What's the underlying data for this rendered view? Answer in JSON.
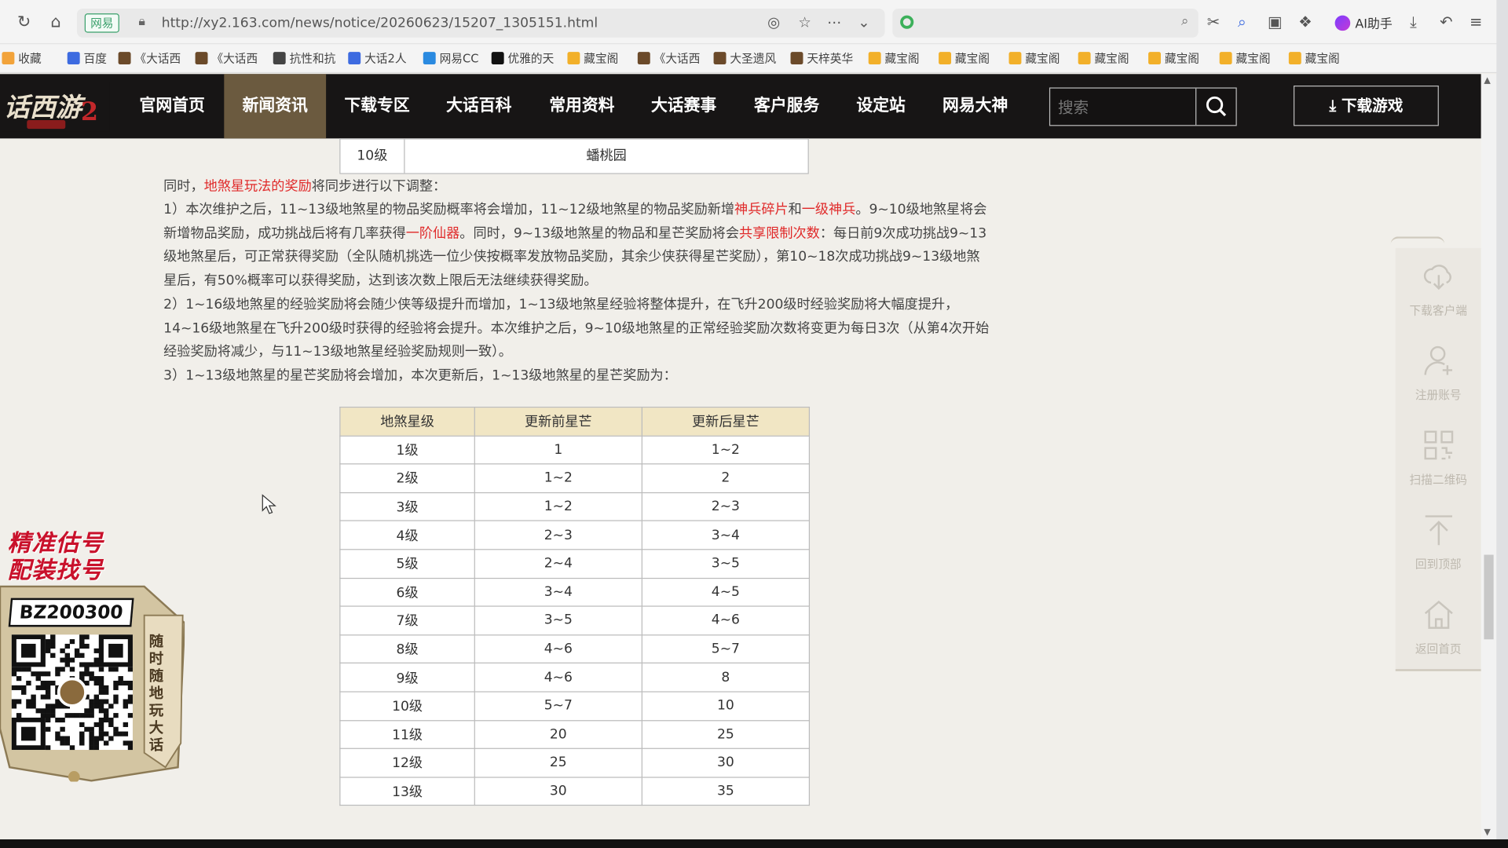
{
  "browser": {
    "site_badge": "网易",
    "url": "http://xy2.163.com/news/notice/20260623/15207_1305151.html",
    "search_placeholder": "",
    "ai_label": "AI助手"
  },
  "bookmarks": [
    {
      "label": "收藏",
      "color": "#f2a33a"
    },
    {
      "label": "百度",
      "color": "#3d6be0"
    },
    {
      "label": "《大话西",
      "color": "#6b4a2a"
    },
    {
      "label": "《大话西",
      "color": "#6b4a2a"
    },
    {
      "label": "抗性和抗",
      "color": "#444444"
    },
    {
      "label": "大话2人",
      "color": "#3d6be0"
    },
    {
      "label": "网易CC",
      "color": "#2a8ae0"
    },
    {
      "label": "优雅的天",
      "color": "#111111"
    },
    {
      "label": "藏宝阁",
      "color": "#f2b02a"
    },
    {
      "label": "《大话西",
      "color": "#6b4a2a"
    },
    {
      "label": "大圣遗风",
      "color": "#6b4a2a"
    },
    {
      "label": "天梓英华",
      "color": "#6b4a2a"
    },
    {
      "label": "藏宝阁",
      "color": "#f2b02a"
    },
    {
      "label": "藏宝阁",
      "color": "#f2b02a"
    },
    {
      "label": "藏宝阁",
      "color": "#f2b02a"
    },
    {
      "label": "藏宝阁",
      "color": "#f2b02a"
    },
    {
      "label": "藏宝阁",
      "color": "#f2b02a"
    },
    {
      "label": "藏宝阁",
      "color": "#f2b02a"
    },
    {
      "label": "藏宝阁",
      "color": "#f2b02a"
    }
  ],
  "site": {
    "menu": [
      "官网首页",
      "新闻资讯",
      "下载专区",
      "大话百科",
      "常用资料",
      "大话赛事",
      "客户服务",
      "设定站",
      "网易大神"
    ],
    "active_menu": "新闻资讯",
    "search_placeholder": "搜索",
    "download_label": "下载游戏"
  },
  "article": {
    "top_row": {
      "level": "10级",
      "place": "蟠桃园"
    },
    "intro": {
      "pre": "同时，",
      "red": "地煞星玩法的奖励",
      "post": "将同步进行以下调整："
    },
    "p1": {
      "a": "1）本次维护之后，11~13级地煞星的物品奖励概率将会增加，11~12级地煞星的物品奖励新增",
      "r1": "神兵碎片",
      "b": "和",
      "r2": "一级神兵",
      "c": "。9~10级地煞星将会新增物品奖励，成功挑战后将有几率获得",
      "r3": "一阶仙器",
      "d": "。同时，9~13级地煞星的物品和星芒奖励将会",
      "r4": "共享限制次数",
      "e": "：每日前9次成功挑战9~13级地煞星后，可正常获得奖励（全队随机挑选一位少侠按概率发放物品奖励，其余少侠获得星芒奖励），第10~18次成功挑战9~13级地煞星后，有50%概率可以获得奖励，达到该次数上限后无法继续获得奖励。"
    },
    "p2": "2）1~16级地煞星的经验奖励将会随少侠等级提升而增加，1~13级地煞星经验将整体提升，在飞升200级时经验奖励将大幅度提升，14~16级地煞星在飞升200级时获得的经验将会提升。本次维护之后，9~10级地煞星的正常经验奖励次数将变更为每日3次（从第4次开始经验奖励将减少，与11~13级地煞星经验奖励规则一致）。",
    "p3": "3）1~13级地煞星的星芒奖励将会增加，本次更新后，1~13级地煞星的星芒奖励为：",
    "table": {
      "headers": [
        "地煞星级",
        "更新前星芒",
        "更新后星芒"
      ],
      "rows": [
        [
          "1级",
          "1",
          "1~2"
        ],
        [
          "2级",
          "1~2",
          "2"
        ],
        [
          "3级",
          "1~2",
          "2~3"
        ],
        [
          "4级",
          "2~3",
          "3~4"
        ],
        [
          "5级",
          "2~4",
          "3~5"
        ],
        [
          "6级",
          "3~4",
          "4~5"
        ],
        [
          "7级",
          "3~5",
          "4~6"
        ],
        [
          "8级",
          "4~6",
          "5~7"
        ],
        [
          "9级",
          "4~6",
          "8"
        ],
        [
          "10级",
          "5~7",
          "10"
        ],
        [
          "11级",
          "20",
          "25"
        ],
        [
          "12级",
          "25",
          "30"
        ],
        [
          "13级",
          "30",
          "35"
        ]
      ]
    }
  },
  "float_bar": [
    {
      "label": "下载客户端",
      "icon": "cloud-download-icon"
    },
    {
      "label": "注册账号",
      "icon": "add-user-icon"
    },
    {
      "label": "扫描二维码",
      "icon": "qr-scan-icon"
    },
    {
      "label": "回到顶部",
      "icon": "arrow-up-icon"
    },
    {
      "label": "返回首页",
      "icon": "home-icon"
    }
  ],
  "promo": {
    "slogan1": "精准估号",
    "slogan2": "配装找号",
    "code": "BZ200300",
    "vertical": "随时随地玩大话"
  },
  "colors": {
    "accent_red": "#e02a2a",
    "header_bg": "#171515",
    "menu_active": "#6b5a3f",
    "table_head": "#f1e6c4"
  }
}
